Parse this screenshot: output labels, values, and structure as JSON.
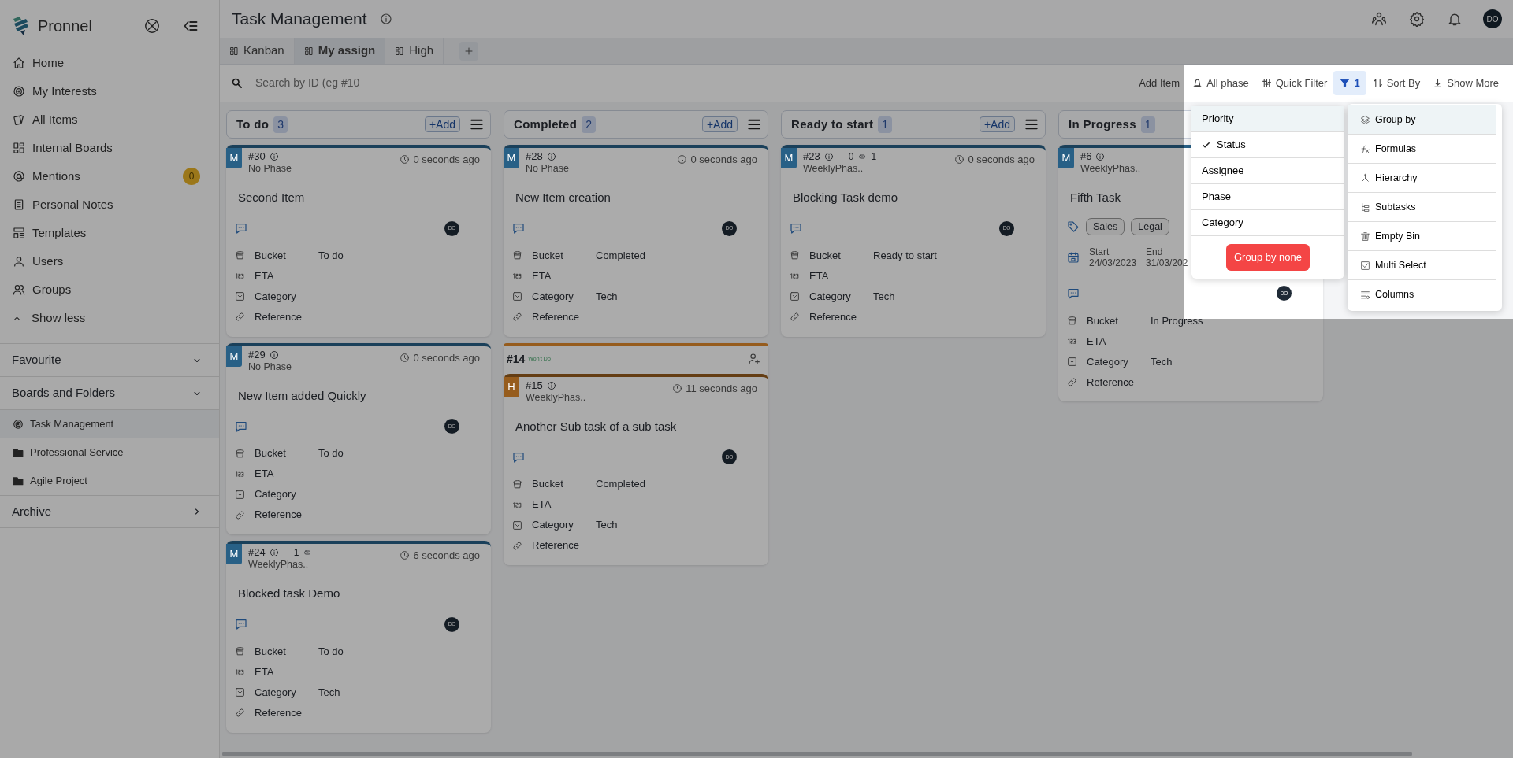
{
  "sidebar": {
    "brand": "Pronnel",
    "nav": [
      {
        "label": "Home"
      },
      {
        "label": "My Interests"
      },
      {
        "label": "All Items"
      },
      {
        "label": "Internal Boards"
      },
      {
        "label": "Mentions",
        "badge": "0"
      },
      {
        "label": "Personal Notes"
      },
      {
        "label": "Templates"
      },
      {
        "label": "Users"
      },
      {
        "label": "Groups"
      }
    ],
    "toggle": "Show less",
    "sections": [
      {
        "title": "Favourite",
        "expanded": true
      },
      {
        "title": "Boards and Folders",
        "expanded": true,
        "children": [
          {
            "kind": "board",
            "label": "Task Management",
            "selected": true
          },
          {
            "kind": "folder",
            "label": "Professional Service",
            "selected": false
          },
          {
            "kind": "folder",
            "label": "Agile Project",
            "selected": false
          }
        ]
      },
      {
        "title": "Archive",
        "expanded": false
      }
    ]
  },
  "header": {
    "title": "Task Management",
    "avatar": "DO"
  },
  "tabs": [
    {
      "label": "Kanban",
      "selected": false
    },
    {
      "label": "My assign",
      "selected": true
    },
    {
      "label": "High",
      "selected": false
    }
  ],
  "toolbar": {
    "search": {
      "placeholder": "Search by ID (eg #10"
    },
    "actions": [
      {
        "kind": "add",
        "label": "Add Item",
        "selected": false
      },
      {
        "kind": "phase",
        "label": "All phase",
        "selected": false
      },
      {
        "kind": "sliders",
        "label": "Quick Filter",
        "selected": false
      },
      {
        "kind": "filter",
        "label": "1",
        "selected": true
      },
      {
        "kind": "sort",
        "label": "Sort By",
        "selected": false
      },
      {
        "kind": "more",
        "label": "Show More",
        "selected": false
      }
    ]
  },
  "columns": [
    {
      "title": "To do",
      "count": "3",
      "add_label": "+Add",
      "cards": [
        {
          "kind": "item",
          "priority": "M",
          "color": "#286086",
          "id": "#30",
          "phase": "No Phase",
          "time": "0 seconds ago",
          "title": "Second Item",
          "avatar": "DO",
          "fields": [
            {
              "kind": "bucket",
              "label": "Bucket",
              "value": "To do"
            },
            {
              "kind": "eta",
              "label": "ETA"
            },
            {
              "kind": "category",
              "label": "Category"
            },
            {
              "kind": "reference",
              "label": "Reference"
            }
          ]
        },
        {
          "kind": "item",
          "priority": "M",
          "color": "#286086",
          "id": "#29",
          "phase": "No Phase",
          "time": "0 seconds ago",
          "title": "New Item added Quickly",
          "avatar": "DO",
          "fields": [
            {
              "kind": "bucket",
              "label": "Bucket",
              "value": "To do"
            },
            {
              "kind": "eta",
              "label": "ETA"
            },
            {
              "kind": "category",
              "label": "Category"
            },
            {
              "kind": "reference",
              "label": "Reference"
            }
          ]
        },
        {
          "kind": "item",
          "priority": "M",
          "color": "#286086",
          "id": "#24",
          "blocking": {
            "before": "1"
          },
          "phase": "WeeklyPhas..",
          "time": "6 seconds ago",
          "title": "Blocked task Demo",
          "avatar": "DO",
          "fields": [
            {
              "kind": "bucket",
              "label": "Bucket",
              "value": "To do"
            },
            {
              "kind": "eta",
              "label": "ETA"
            },
            {
              "kind": "category",
              "label": "Category",
              "value": "Tech"
            },
            {
              "kind": "reference",
              "label": "Reference"
            }
          ]
        }
      ]
    },
    {
      "title": "Completed",
      "count": "2",
      "add_label": "+Add",
      "cards": [
        {
          "kind": "item",
          "priority": "M",
          "color": "#286086",
          "id": "#28",
          "phase": "No Phase",
          "time": "0 seconds ago",
          "title": "New Item creation",
          "avatar": "DO",
          "fields": [
            {
              "kind": "bucket",
              "label": "Bucket",
              "value": "Completed"
            },
            {
              "kind": "eta",
              "label": "ETA"
            },
            {
              "kind": "category",
              "label": "Category",
              "value": "Tech"
            },
            {
              "kind": "reference",
              "label": "Reference"
            }
          ]
        },
        {
          "kind": "group",
          "id": "#14",
          "status": "Won't Do",
          "color": "#965c1d",
          "children": [
            {
              "kind": "item",
              "priority": "H",
              "color": "#965c1d",
              "id": "#15",
              "phase": "WeeklyPhas..",
              "time": "11 seconds ago",
              "title": "Another Sub task of a sub task",
              "avatar": "DO",
              "fields": [
                {
                  "kind": "bucket",
                  "label": "Bucket",
                  "value": "Completed"
                },
                {
                  "kind": "eta",
                  "label": "ETA"
                },
                {
                  "kind": "category",
                  "label": "Category",
                  "value": "Tech"
                },
                {
                  "kind": "reference",
                  "label": "Reference"
                }
              ]
            }
          ]
        }
      ]
    },
    {
      "title": "Ready to start",
      "count": "1",
      "add_label": "+Add",
      "cards": [
        {
          "kind": "item",
          "priority": "M",
          "color": "#286086",
          "id": "#23",
          "blocking": {
            "before": "0",
            "after": "1"
          },
          "phase": "WeeklyPhas..",
          "time": "0 seconds ago",
          "title": "Blocking Task demo",
          "avatar": "DO",
          "fields": [
            {
              "kind": "bucket",
              "label": "Bucket",
              "value": "Ready to start"
            },
            {
              "kind": "eta",
              "label": "ETA"
            },
            {
              "kind": "category",
              "label": "Category",
              "value": "Tech"
            },
            {
              "kind": "reference",
              "label": "Reference"
            }
          ]
        }
      ]
    },
    {
      "title": "In Progress",
      "count": "1",
      "cards": [
        {
          "kind": "item",
          "priority": "M",
          "color": "#286086",
          "id": "#6",
          "phase": "WeeklyPhas..",
          "title": "Fifth Task",
          "tags": [
            "Sales",
            "Legal"
          ],
          "dates": {
            "start_label": "Start",
            "start": "24/03/2023",
            "end_label": "End",
            "end": "31/03/202"
          },
          "avatar": "DO",
          "fields": [
            {
              "kind": "bucket",
              "label": "Bucket",
              "value": "In Progress"
            },
            {
              "kind": "eta",
              "label": "ETA"
            },
            {
              "kind": "category",
              "label": "Category",
              "value": "Tech"
            },
            {
              "kind": "reference",
              "label": "Reference"
            }
          ]
        }
      ]
    }
  ],
  "group_by_menu": {
    "items": [
      {
        "label": "Priority",
        "selected": true,
        "checked": false
      },
      {
        "label": "Status",
        "selected": false,
        "checked": true
      },
      {
        "label": "Assignee",
        "selected": false,
        "checked": false
      },
      {
        "label": "Phase",
        "selected": false,
        "checked": false
      },
      {
        "label": "Category",
        "selected": false,
        "checked": false
      }
    ],
    "button": "Group by none"
  },
  "show_more_menu": {
    "items": [
      {
        "kind": "layers",
        "label": "Group by",
        "selected": true
      },
      {
        "kind": "formula",
        "label": "Formulas",
        "selected": false
      },
      {
        "kind": "hierarchy",
        "label": "Hierarchy",
        "selected": false
      },
      {
        "kind": "subtasks",
        "label": "Subtasks",
        "selected": false
      },
      {
        "kind": "trash",
        "label": "Empty Bin",
        "selected": false
      },
      {
        "kind": "checkbox",
        "label": "Multi Select",
        "selected": false
      },
      {
        "kind": "columns",
        "label": "Columns",
        "selected": false
      }
    ]
  },
  "overlay": {
    "dimmed": true
  }
}
